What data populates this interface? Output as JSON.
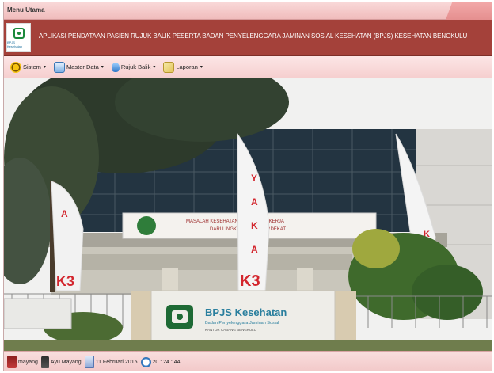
{
  "window": {
    "title": "Menu Utama"
  },
  "banner": {
    "logo_text": "BPJS Kesehatan",
    "title": "APLIKASI PENDATAAN PASIEN RUJUK BALIK PESERTA BADAN PENYELENGGARA JAMINAN SOSIAL KESEHATAN (BPJS) KESEHATAN BENGKULU"
  },
  "menu": [
    {
      "label": "Sistem",
      "icon": "gear-icon"
    },
    {
      "label": "Master Data",
      "icon": "database-icon"
    },
    {
      "label": "Rujuk Balik",
      "icon": "drop-icon"
    },
    {
      "label": "Laporan",
      "icon": "report-icon"
    }
  ],
  "photo": {
    "sign_main": "BPJS Kesehatan",
    "sign_sub": "Badan Penyelenggara Jaminan Sosial",
    "sign_branch": "KANTOR CABANG BENGKULU",
    "banner_text_1": "MASALAH KESEHATAN KESEHATAN KERJA",
    "banner_text_2": "DARI LINGKUP KERJA TERDEKAT",
    "flag_text": "BUDAYAKAN K3",
    "flag_k3": "K3"
  },
  "status": {
    "user": "mayang",
    "name": "Ayu Mayang",
    "date": "11 Februari 2015",
    "time": "20 : 24 : 44"
  },
  "colors": {
    "banner": "#a4413a",
    "menubar": "#f6cfcf",
    "accent": "#1b8a3b"
  }
}
